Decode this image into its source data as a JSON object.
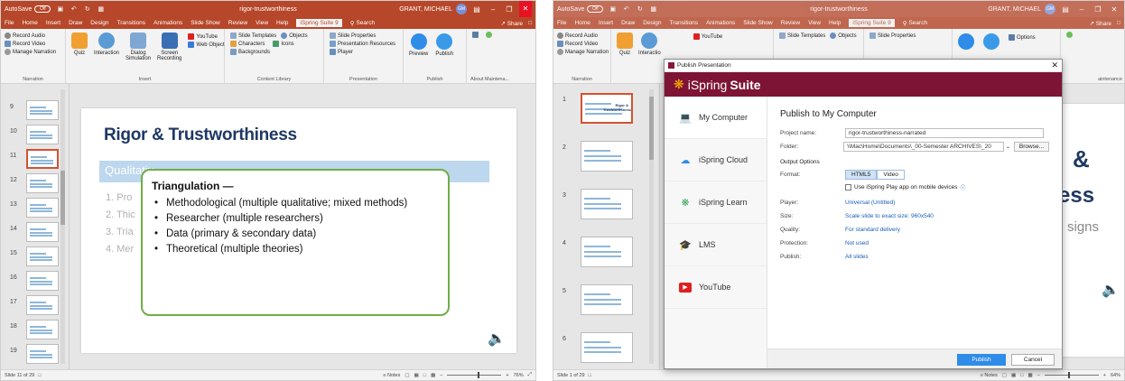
{
  "left": {
    "titlebar": {
      "autosave": "AutoSave",
      "autosave_state": "Off",
      "doc_title": "rigor-trustworthiness",
      "user": "GRANT, MICHAEL",
      "user_initials": "GM"
    },
    "tabs": [
      "File",
      "Home",
      "Insert",
      "Draw",
      "Design",
      "Transitions",
      "Animations",
      "Slide Show",
      "Review",
      "View",
      "Help",
      "iSpring Suite 9"
    ],
    "search_label": "Search",
    "share_label": "Share",
    "ribbon": {
      "narration": {
        "items": [
          "Record Audio",
          "Record Video",
          "Manage Narration"
        ],
        "label": "Narration"
      },
      "insert": {
        "big": [
          "Quiz",
          "Interaction",
          "Dialog Simulation",
          "Screen Recording"
        ],
        "small": [
          "YouTube",
          "Web Object"
        ],
        "label": "Insert"
      },
      "content": {
        "items": [
          "Slide Templates",
          "Objects",
          "Characters",
          "Icons",
          "Backgrounds"
        ],
        "label": "Content Library"
      },
      "presentation": {
        "items": [
          "Slide Properties",
          "Presentation Resources",
          "Player"
        ],
        "label": "Presentation"
      },
      "publish": {
        "big": [
          "Preview",
          "Publish"
        ],
        "label": "Publish"
      },
      "about": {
        "label": "About",
        "maint": "Maintena..."
      }
    },
    "thumb_numbers": [
      "9",
      "10",
      "11",
      "12",
      "13",
      "14",
      "15",
      "16",
      "17",
      "18",
      "19"
    ],
    "slide": {
      "title": "Rigor & Trustworthiness",
      "band": "Qualitativ",
      "list": [
        "1. Pro",
        "2. Thic",
        "3. Tria",
        "4. Mer"
      ],
      "callout_title": "Triangulation —",
      "callout_items": [
        "Methodological (multiple qualitative; mixed methods)",
        "Researcher (multiple researchers)",
        "Data (primary & secondary data)",
        "Theoretical (multiple theories)"
      ]
    },
    "status": {
      "slide_info": "Slide 11 of 29",
      "notes": "Notes",
      "zoom": "76%"
    }
  },
  "right": {
    "titlebar": {
      "autosave": "AutoSave",
      "autosave_state": "Off",
      "doc_title": "rigor-trustworthiness",
      "user": "GRANT, MICHAEL",
      "user_initials": "GM"
    },
    "tabs": [
      "File",
      "Home",
      "Insert",
      "Draw",
      "Design",
      "Transitions",
      "Animations",
      "Slide Show",
      "Review",
      "View",
      "Help",
      "iSpring Suite 9"
    ],
    "search_label": "Search",
    "share_label": "Share",
    "ribbon": {
      "narration": {
        "items": [
          "Record Audio",
          "Record Video",
          "Manage Narration"
        ],
        "label": "Narration"
      },
      "quiz": [
        "Quiz",
        "Interactio"
      ],
      "youtube": "YouTube",
      "content": [
        "Slide Templates",
        "Objects"
      ],
      "slide_props": "Slide Properties",
      "options": "Options",
      "maint": "aintenance"
    },
    "thumb_numbers": [
      "1",
      "2",
      "3",
      "4",
      "5",
      "6"
    ],
    "thumb1_title": "Rigor & Trustworthiness",
    "behind": {
      "amp": "&",
      "ss": "ess",
      "signs": "signs",
      "cl": "Cl"
    },
    "status": {
      "slide_info": "Slide 1 of 29",
      "notes": "Notes",
      "zoom": "64%"
    },
    "dialog": {
      "window_title": "Publish Presentation",
      "brand": "iSpring",
      "brand_bold": "Suite",
      "nav": [
        "My Computer",
        "iSpring Cloud",
        "iSpring Learn",
        "LMS",
        "YouTube"
      ],
      "heading": "Publish to My Computer",
      "project_label": "Project name:",
      "project_value": "rigor-trustworthiness-narrated",
      "folder_label": "Folder:",
      "folder_value": "\\\\Mac\\Home\\Documents\\_00-Semester ARCHIVES\\_20",
      "browse": "Browse...",
      "output_options": "Output Options",
      "format_label": "Format:",
      "format_options": [
        "HTML5",
        "Video"
      ],
      "mobile_check": "Use iSpring Play app on mobile devices",
      "player_label": "Player:",
      "player_value": "Universal (Untitled)",
      "size_label": "Size:",
      "size_value": "Scale slide to exact size: 960x540",
      "quality_label": "Quality:",
      "quality_value": "For standard delivery",
      "protection_label": "Protection:",
      "protection_value": "Not used",
      "publish_label": "Publish:",
      "publish_value": "All slides",
      "btn_publish": "Publish",
      "btn_cancel": "Cancel"
    }
  }
}
